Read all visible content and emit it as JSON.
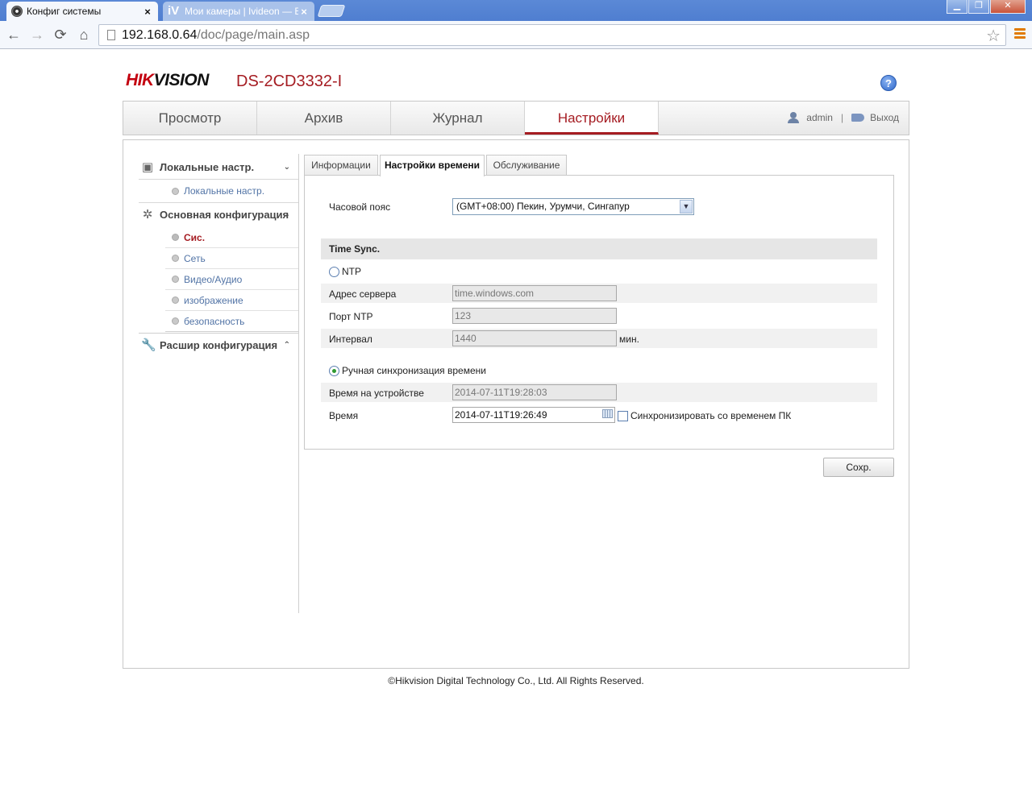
{
  "browser": {
    "tabs": [
      {
        "title": "Конфиг системы",
        "close": "×"
      },
      {
        "title": "Мои камеры | Ivideon — Ви",
        "icon_text": "iV",
        "close": "×"
      }
    ],
    "window_buttons": {
      "minimize": "▁",
      "restore": "❐",
      "close": "✕"
    },
    "url_host": "192.168.0.64",
    "url_path": "/doc/page/main.asp",
    "nav": {
      "back": "←",
      "forward": "→",
      "reload": "⟳",
      "home": "⌂",
      "star": "☆"
    }
  },
  "header": {
    "brand_red": "HIK",
    "brand_black": "VISION",
    "model": "DS-2CD3332-I",
    "help": "?"
  },
  "main_nav": {
    "tabs": [
      "Просмотр",
      "Архив",
      "Журнал",
      "Настройки"
    ],
    "active_index": 3,
    "user": "admin",
    "separator": "|",
    "logout": "Выход"
  },
  "sidebar": {
    "groups": [
      {
        "label": "Локальные настр.",
        "chevron": "⌄",
        "items": [
          "Локальные настр."
        ]
      },
      {
        "label": "Основная конфигурация",
        "chevron": "⌄",
        "items": [
          "Сис.",
          "Сеть",
          "Видео/Аудио",
          "изображение",
          "безопасность"
        ]
      },
      {
        "label": "Расшир конфигурация",
        "chevron": "⌃",
        "items": []
      }
    ],
    "active_item": "Сис."
  },
  "subtabs": [
    "Информации",
    "Настройки времени",
    "Обслуживание"
  ],
  "time_settings": {
    "timezone_label": "Часовой пояс",
    "timezone_value": "(GMT+08:00) Пекин, Урумчи, Сингапур",
    "section_title": "Time Sync.",
    "ntp_label": "NTP",
    "server_label": "Адрес сервера",
    "server_value": "time.windows.com",
    "port_label": "Порт NTP",
    "port_value": "123",
    "interval_label": "Интервал",
    "interval_value": "1440",
    "interval_unit": "мин.",
    "manual_label": "Ручная синхронизация времени",
    "device_time_label": "Время на устройстве",
    "device_time_value": "2014-07-11T19:28:03",
    "time_label": "Время",
    "time_value": "2014-07-11T19:26:49",
    "sync_pc_label": "Синхронизировать со временем ПК",
    "selected_mode": "manual",
    "sync_pc_checked": false
  },
  "save_label": "Сохр.",
  "footer": "©Hikvision Digital Technology Co., Ltd. All Rights Reserved."
}
